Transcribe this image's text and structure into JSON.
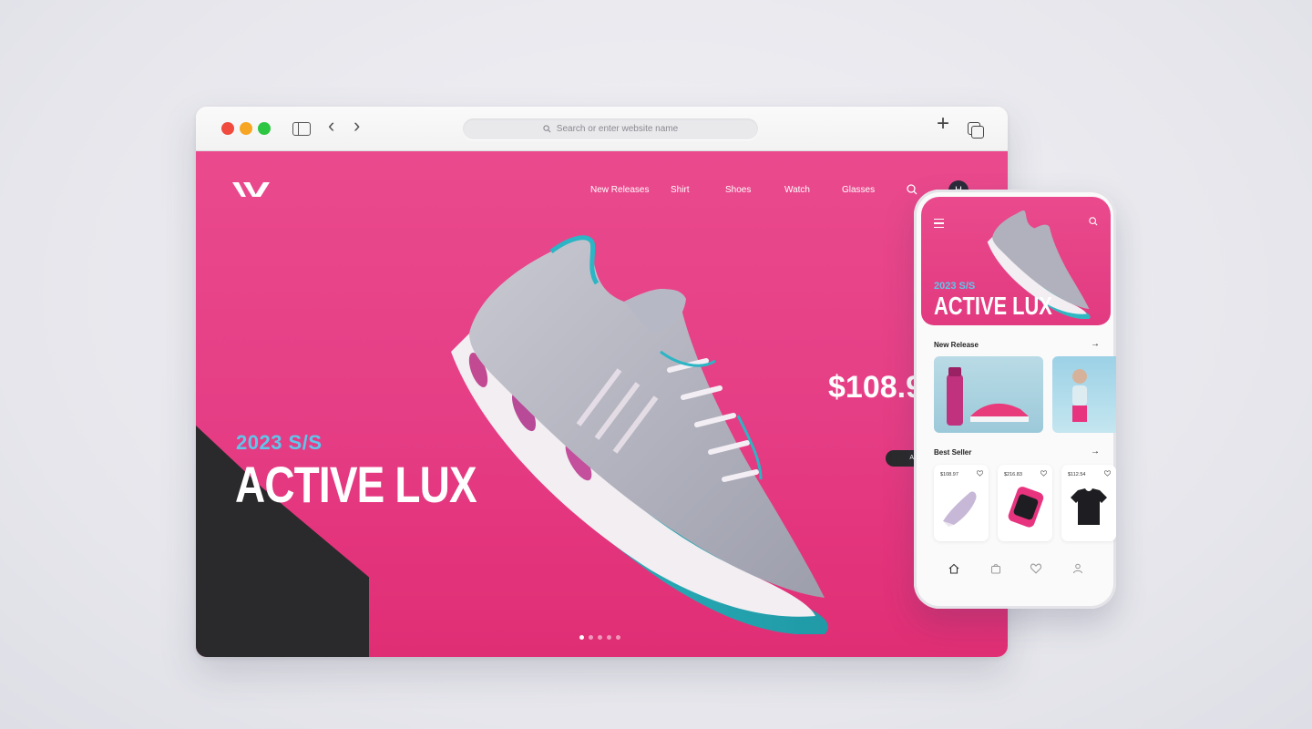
{
  "browser": {
    "address_placeholder": "Search or enter website name"
  },
  "site": {
    "nav": [
      "New Releases",
      "Shirt",
      "Shoes",
      "Watch",
      "Glasses"
    ],
    "avatar_initial": "H",
    "hero": {
      "season": "2023 S/S",
      "title": "ACTIVE LUX",
      "price": "$108.9",
      "cta": "ADD TO"
    },
    "pager": {
      "total": 5,
      "active": 1
    },
    "colors": {
      "brand_pink": "#e53d85",
      "accent_cyan": "#5fc6ea",
      "dark": "#2a2a2c"
    }
  },
  "mobile": {
    "hero": {
      "season": "2023 S/S",
      "title": "ACTIVE LUX"
    },
    "new_release": {
      "title": "New Release",
      "arrow": "→"
    },
    "best_seller": {
      "title": "Best Seller",
      "arrow": "→",
      "products": [
        {
          "price": "$108.97",
          "icon": "sneaker-icon"
        },
        {
          "price": "$216.83",
          "icon": "smartwatch-icon"
        },
        {
          "price": "$112.54",
          "icon": "tshirt-icon"
        }
      ]
    },
    "tabbar": [
      "home-icon",
      "bag-icon",
      "heart-icon",
      "user-icon"
    ]
  }
}
